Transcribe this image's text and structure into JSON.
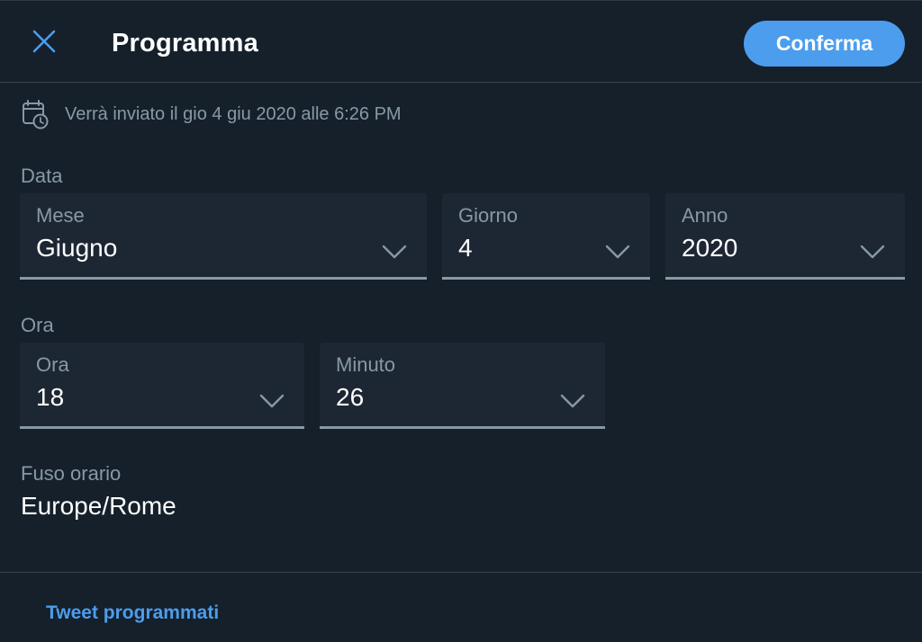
{
  "header": {
    "title": "Programma",
    "confirm_label": "Conferma",
    "close_icon": "close-icon"
  },
  "schedule": {
    "icon": "calendar-clock-icon",
    "text": "Verrà inviato il gio 4 giu 2020 alle 6:26 PM"
  },
  "date": {
    "section_label": "Data",
    "month": {
      "label": "Mese",
      "value": "Giugno"
    },
    "day": {
      "label": "Giorno",
      "value": "4"
    },
    "year": {
      "label": "Anno",
      "value": "2020"
    }
  },
  "time": {
    "section_label": "Ora",
    "hour": {
      "label": "Ora",
      "value": "18"
    },
    "minute": {
      "label": "Minuto",
      "value": "26"
    }
  },
  "timezone": {
    "label": "Fuso orario",
    "value": "Europe/Rome"
  },
  "footer": {
    "link_label": "Tweet programmati"
  },
  "colors": {
    "background": "#15202b",
    "field_bg": "#1d2733",
    "accent": "#4c9ded",
    "muted_text": "#8899a6",
    "divider": "#38444d"
  }
}
